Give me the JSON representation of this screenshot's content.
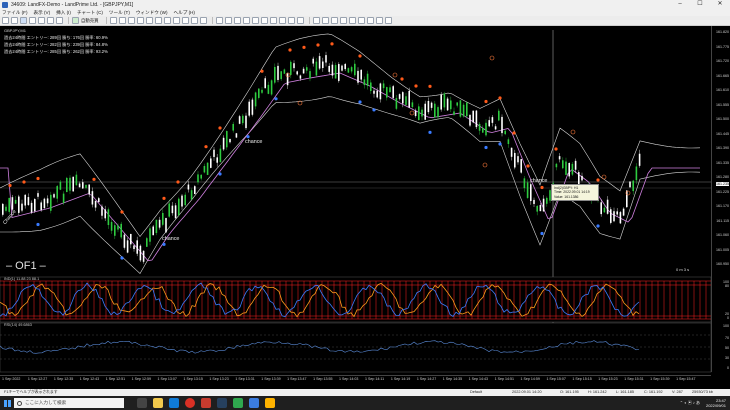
{
  "window": {
    "title": "34609: LandFX-Demo - LandPrime Ltd. - [GBPJPY,M1]"
  },
  "menu": [
    "ファイル (F)",
    "表示 (V)",
    "挿入 (I)",
    "チャート (C)",
    "ツール (T)",
    "ウィンドウ (W)",
    "ヘルプ (H)"
  ],
  "toolbar": {
    "autotrade_label": "自動売買"
  },
  "chart": {
    "symbol_label": "GBPJPY,M1",
    "stats": [
      "過去24時間  エントリー: 289回  勝ち: 176回  勝率: 60.9%",
      "過去24時間  エントリー: 282回  勝ち: 239回  勝率: 84.8%",
      "過去24時間  エントリー: 285回  勝ち: 262回  勝率: 93.2%"
    ],
    "of1_label": "– OF1 –",
    "timer": "0 m 3 s",
    "chance_labels": [
      "chance",
      "chance",
      "chance"
    ],
    "chance_label_vertical": "Chance",
    "indicator1_label": "IND(1) 11.88 23 88.1",
    "indicator2_label": "RSI(14) 49.6863",
    "price_labels": [
      "161.820",
      "161.775",
      "161.720",
      "161.665",
      "161.610",
      "161.555",
      "161.500",
      "161.445",
      "161.390",
      "161.335",
      "161.280",
      "161.225",
      "161.170",
      "161.115",
      "161.060",
      "161.005",
      "160.950"
    ],
    "current_price": "161.235",
    "ind1_scale": [
      "100",
      "80",
      "20",
      "0"
    ],
    "ind2_scale": [
      "100",
      "70",
      "50",
      "30",
      "0"
    ],
    "time_labels": [
      "1 Sep 2022",
      "1 Sep 12:27",
      "1 Sep 12:35",
      "1 Sep 12:43",
      "1 Sep 12:51",
      "1 Sep 12:59",
      "1 Sep 13:07",
      "1 Sep 13:15",
      "1 Sep 13:23",
      "1 Sep 13:31",
      "1 Sep 13:39",
      "1 Sep 13:47",
      "1 Sep 13:55",
      "1 Sep 14:03",
      "1 Sep 14:11",
      "1 Sep 14:19",
      "1 Sep 14:27",
      "1 Sep 14:35",
      "1 Sep 14:43",
      "1 Sep 14:51",
      "1 Sep 14:59",
      "1 Sep 15:07",
      "1 Sep 15:15",
      "1 Sep 15:23",
      "1 Sep 15:31",
      "1 Sep 15:39",
      "1 Sep 15:47"
    ],
    "tooltip": [
      "Ind(2)GBPY: H1",
      "Time: 2022.09.01 14:19",
      "Value: 161.1386"
    ]
  },
  "statusbar": {
    "help": "F1キーでヘルプが表示されます",
    "profile": "Default",
    "datetime": "2022.09.01 14:20",
    "open": "O: 161.195",
    "high": "H: 161.242",
    "low": "L: 161.185",
    "close": "C: 161.192",
    "volume": "V: 287",
    "traffic": "25930/73 kb"
  },
  "taskbar": {
    "search_placeholder": "ここに入力して検索",
    "time": "23:47",
    "date": "2022/09/01"
  },
  "colors": {
    "candle_up": "#2ecc40",
    "candle_down": "#ffffff",
    "bollinger": "#d9d9d9",
    "ma": "#d080e0",
    "ind_red": "#ff2020",
    "ind_orange": "#ff9a1a",
    "ind_blue": "#3a7bff"
  }
}
